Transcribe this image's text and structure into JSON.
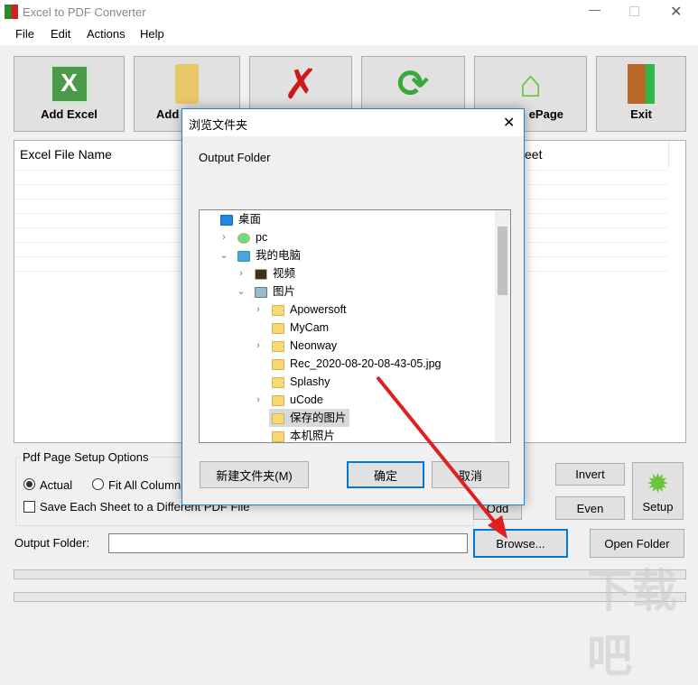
{
  "window": {
    "title": "Excel to PDF Converter"
  },
  "menu": [
    "File",
    "Edit",
    "Actions",
    "Help"
  ],
  "toolbar": [
    {
      "label": "Add Excel",
      "icon": "excel-icon"
    },
    {
      "label": "Add",
      "icon": "folder-icon"
    },
    {
      "label": "",
      "icon": "delete-x-icon"
    },
    {
      "label": "",
      "icon": "refresh-icon"
    },
    {
      "label": "ePage",
      "icon": "home-icon"
    },
    {
      "label": "Exit",
      "icon": "exit-door-icon"
    }
  ],
  "list": {
    "col1": "Excel File Name",
    "col2": "eet"
  },
  "options": {
    "group": "Pdf Page Setup Options",
    "actual": "Actual",
    "fit": "Fit All Columns",
    "save_each": "Save Each Sheet to a Different PDF File",
    "actual_selected": true,
    "save_each_checked": false
  },
  "buttons": {
    "invert": "Invert",
    "odd": "Odd",
    "even": "Even",
    "setup": "Setup",
    "browse": "Browse...",
    "open_folder": "Open Folder"
  },
  "output": {
    "label": "Output Folder:",
    "value": ""
  },
  "dialog": {
    "title": "浏览文件夹",
    "prompt": "Output Folder",
    "new_folder": "新建文件夹(M)",
    "ok": "确定",
    "cancel": "取消",
    "tree": [
      {
        "label": "桌面",
        "level": 0,
        "chev": "",
        "icon": "desktop"
      },
      {
        "label": "pc",
        "level": 1,
        "chev": ">",
        "icon": "user"
      },
      {
        "label": "我的电脑",
        "level": 1,
        "chev": "v",
        "icon": "computer"
      },
      {
        "label": "视频",
        "level": 2,
        "chev": ">",
        "icon": "video"
      },
      {
        "label": "图片",
        "level": 2,
        "chev": "v",
        "icon": "pictures"
      },
      {
        "label": "Apowersoft",
        "level": 3,
        "chev": ">",
        "icon": "folder"
      },
      {
        "label": "MyCam",
        "level": 3,
        "chev": "",
        "icon": "folder"
      },
      {
        "label": "Neonway",
        "level": 3,
        "chev": ">",
        "icon": "folder"
      },
      {
        "label": "Rec_2020-08-20-08-43-05.jpg",
        "level": 3,
        "chev": "",
        "icon": "folder"
      },
      {
        "label": "Splashy",
        "level": 3,
        "chev": "",
        "icon": "folder"
      },
      {
        "label": "uCode",
        "level": 3,
        "chev": ">",
        "icon": "folder"
      },
      {
        "label": "保存的图片",
        "level": 3,
        "chev": "",
        "icon": "folder",
        "selected": true
      },
      {
        "label": "本机照片",
        "level": 3,
        "chev": "",
        "icon": "folder"
      }
    ]
  },
  "colors": {
    "accent": "#0078d7",
    "arrow": "#e02020"
  }
}
